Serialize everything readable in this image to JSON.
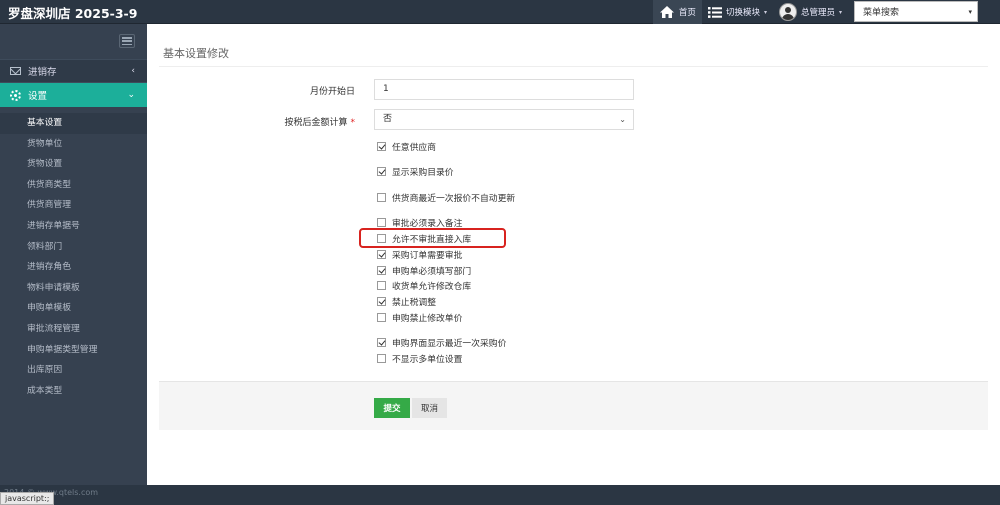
{
  "header": {
    "brand": "罗盘深圳店 2025-3-9",
    "home_label": "首页",
    "switch_module_label": "切换模块",
    "user_label": "总管理员",
    "menu_search_value": "菜单搜索"
  },
  "sidebar": {
    "items": [
      {
        "label": "进销存",
        "icon": "envelope-icon",
        "expanded": false
      },
      {
        "label": "设置",
        "icon": "gear-icon",
        "expanded": true,
        "active": true
      }
    ],
    "submenu": [
      {
        "label": "基本设置",
        "active": true
      },
      {
        "label": "货物单位"
      },
      {
        "label": "货物设置"
      },
      {
        "label": "供货商类型"
      },
      {
        "label": "供货商管理"
      },
      {
        "label": "进销存单据号"
      },
      {
        "label": "领料部门"
      },
      {
        "label": "进销存角色"
      },
      {
        "label": "物料申请模板"
      },
      {
        "label": "申购单模板"
      },
      {
        "label": "审批流程管理"
      },
      {
        "label": "申购单据类型管理"
      },
      {
        "label": "出库原因"
      },
      {
        "label": "成本类型"
      }
    ]
  },
  "form": {
    "page_title": "基本设置修改",
    "month_start_label": "月份开始日",
    "month_start_value": "1",
    "after_tax_label": "按税后金额计算",
    "after_tax_required": "*",
    "after_tax_value": "否",
    "options": [
      {
        "label": "任意供应商",
        "checked": true
      },
      {
        "label": "显示采购目录价",
        "checked": true
      },
      {
        "label": "供货商最近一次报价不自动更新",
        "checked": false
      },
      {
        "label": "审批必须录入备注",
        "checked": false
      },
      {
        "label": "允许不审批直接入库",
        "checked": false,
        "highlighted": true
      },
      {
        "label": "采购订单需要审批",
        "checked": true
      },
      {
        "label": "申购单必须填写部门",
        "checked": true
      },
      {
        "label": "收货单允许修改仓库",
        "checked": false
      },
      {
        "label": "禁止税调整",
        "checked": true
      },
      {
        "label": "申购禁止修改单价",
        "checked": false
      },
      {
        "label": "申购界面显示最近一次采购价",
        "checked": true
      },
      {
        "label": "不显示多单位设置",
        "checked": false
      }
    ],
    "submit_label": "提交",
    "cancel_label": "取消"
  },
  "footer": {
    "copyright": "2014 © www.qtels.com",
    "status_url": "javascript:;"
  },
  "colors": {
    "accent": "#1caf9a",
    "submit": "#35aa47",
    "highlight_border": "#d8231f"
  }
}
